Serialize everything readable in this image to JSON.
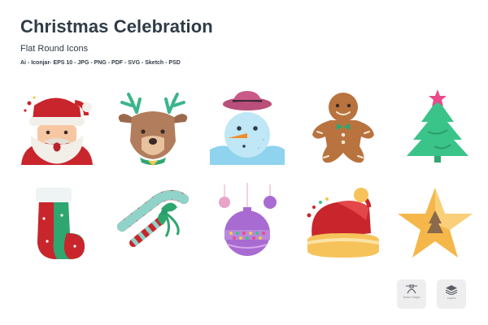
{
  "header": {
    "title": "Christmas Celebration",
    "subtitle": "Flat Round Icons",
    "formats": "Ai - Iconjar- EPS 10 - JPG - PNG - PDF - SVG - Sketch - PSD"
  },
  "icons": [
    {
      "name": "santa-claus-icon"
    },
    {
      "name": "reindeer-icon"
    },
    {
      "name": "snowman-icon"
    },
    {
      "name": "gingerbread-man-icon"
    },
    {
      "name": "christmas-tree-icon"
    },
    {
      "name": "christmas-stocking-icon"
    },
    {
      "name": "candy-cane-icon"
    },
    {
      "name": "christmas-ornament-icon"
    },
    {
      "name": "santa-hat-icon"
    },
    {
      "name": "christmas-star-icon"
    }
  ],
  "toolbar": {
    "vector_label": "Vector Shape",
    "layers_label": "Layers"
  }
}
